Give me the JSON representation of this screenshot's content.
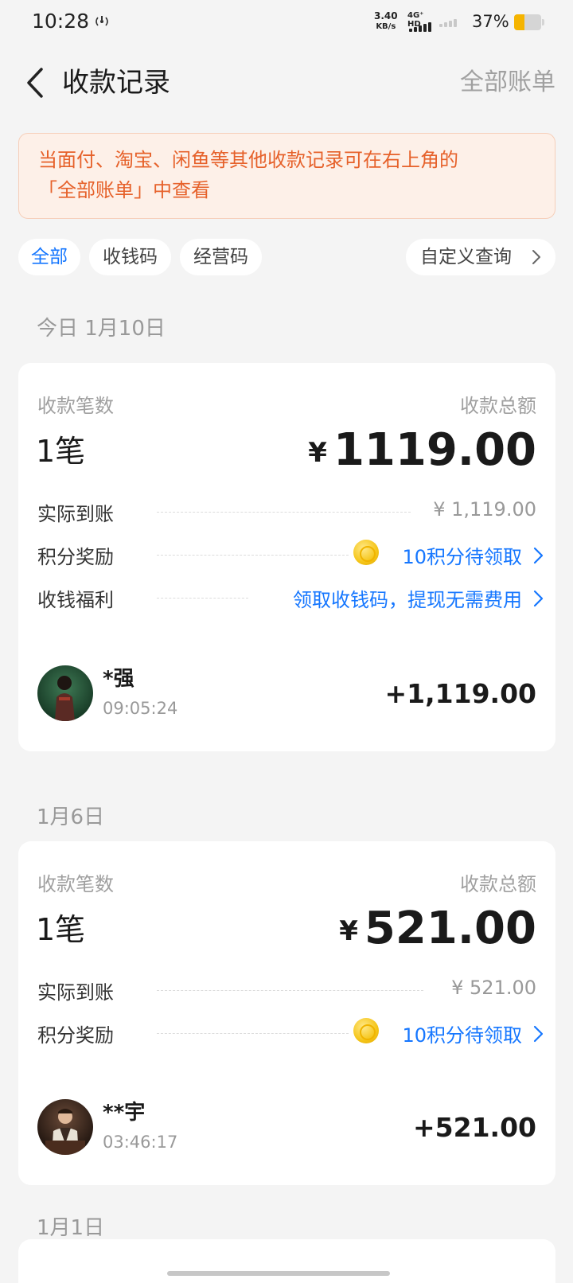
{
  "status_bar": {
    "time": "10:28",
    "net_speed_value": "3.40",
    "net_speed_unit": "KB/s",
    "network_type": "4G⁺ HD",
    "battery_percent": "37%",
    "battery_level": 0.37,
    "battery_color": "#f5b400"
  },
  "header": {
    "title": "收款记录",
    "all_bills": "全部账单"
  },
  "notice": {
    "text_line1": "当面付、淘宝、闲鱼等其他收款记录可在右上角的",
    "text_line2": "「全部账单」中查看"
  },
  "filters": {
    "chips": [
      "全部",
      "收钱码",
      "经营码"
    ],
    "active": "全部",
    "custom_query": "自定义查询"
  },
  "groups": [
    {
      "date": "今日 1月10日",
      "count_label": "收款笔数",
      "count": "1笔",
      "total_label": "收款总额",
      "currency": "¥",
      "total": "1119.00",
      "details": [
        {
          "label": "实际到账",
          "value": "¥ 1,119.00"
        },
        {
          "label": "积分奖励",
          "value": "10积分待领取"
        },
        {
          "label": "收钱福利",
          "value": "领取收钱码，提现无需费用"
        }
      ],
      "transactions": [
        {
          "name": "*强",
          "time": "09:05:24",
          "amount": "+1,119.00"
        }
      ]
    },
    {
      "date": "1月6日",
      "count_label": "收款笔数",
      "count": "1笔",
      "total_label": "收款总额",
      "currency": "¥",
      "total": "521.00",
      "details": [
        {
          "label": "实际到账",
          "value": "¥ 521.00"
        },
        {
          "label": "积分奖励",
          "value": "10积分待领取"
        }
      ],
      "transactions": [
        {
          "name": "**宇",
          "time": "03:46:17",
          "amount": "+521.00"
        }
      ]
    },
    {
      "date": "1月1日"
    }
  ],
  "colors": {
    "accent": "#1677ff",
    "notice_text": "#e6612a",
    "notice_bg": "#fdf0e8",
    "background": "#f4f4f4"
  }
}
